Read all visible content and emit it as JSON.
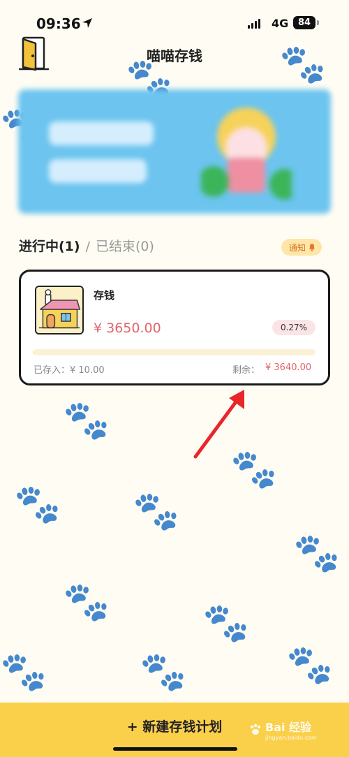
{
  "status_bar": {
    "time": "09:36",
    "network": "4G",
    "battery": "84"
  },
  "header": {
    "title": "喵喵存钱",
    "exit_icon": "door-icon"
  },
  "banner": {
    "state": "blurred promotional image"
  },
  "tabs": {
    "active": "进行中(1)",
    "separator": "/",
    "inactive": "已结束(0)"
  },
  "notify_button": {
    "label": "通知",
    "icon": "bell-icon"
  },
  "plan_card": {
    "name": "存钱",
    "icon": "house-icon",
    "amount": "¥ 3650.00",
    "percent": "0.27%",
    "progress_fraction": 0.0027,
    "saved": "已存入：¥ 10.00",
    "remaining_label": "剩余：",
    "remaining_value": "¥ 3640.00"
  },
  "bottom_button": {
    "label": "+ 新建存钱计划"
  },
  "watermark": {
    "text": "Bai  经验",
    "sub": "jingyan.baidu.com"
  },
  "colors": {
    "accent_yellow": "#fad04b",
    "amount_red": "#e0646c",
    "banner_blue": "#6cc4ef",
    "annotation_arrow": "#e8262a"
  }
}
